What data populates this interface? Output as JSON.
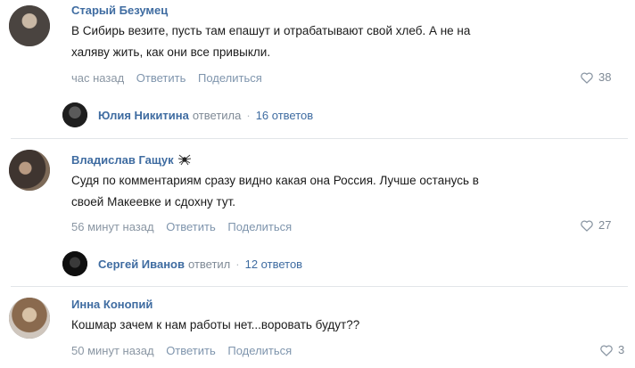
{
  "comments": [
    {
      "author": "Старый Безумец",
      "text_lines": [
        "В Сибирь везите, пусть там епашут и отрабатывают свой хлеб. А не на",
        "халяву жить, как они все привыкли."
      ],
      "time": "час назад",
      "reply_label": "Ответить",
      "share_label": "Поделиться",
      "likes": "38",
      "thread": {
        "name": "Юлия Никитина",
        "verb": "ответила",
        "count": "16 ответов"
      }
    },
    {
      "author": "Владислав Гащук",
      "author_badge": "spider-icon",
      "text_lines": [
        "Судя по комментариям сразу видно какая она Россия. Лучше останусь в",
        "своей Макеевке и сдохну тут."
      ],
      "time": "56 минут назад",
      "reply_label": "Ответить",
      "share_label": "Поделиться",
      "likes": "27",
      "thread": {
        "name": "Сергей Иванов",
        "verb": "ответил",
        "count": "12 ответов"
      }
    },
    {
      "author": "Инна Конопий",
      "text_lines": [
        "Кошмар зачем к нам работы нет...воровать будут??"
      ],
      "time": "50 минут назад",
      "reply_label": "Ответить",
      "share_label": "Поделиться",
      "likes": "3"
    }
  ],
  "colors": {
    "author": "#3f6ca1",
    "meta": "#8a96a3",
    "text": "#1a1a1a"
  }
}
